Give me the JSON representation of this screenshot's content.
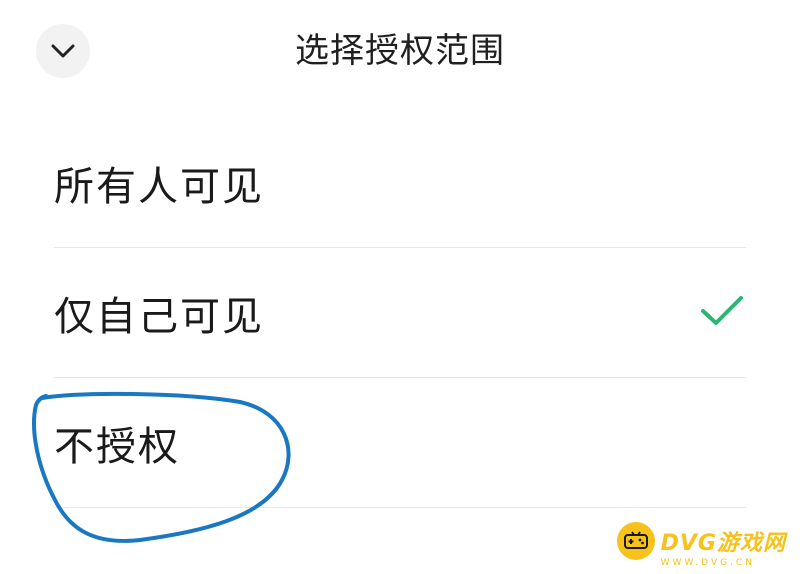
{
  "header": {
    "back_icon": "chevron-down-icon",
    "title": "选择授权范围"
  },
  "options": [
    {
      "label": "所有人可见",
      "selected": false
    },
    {
      "label": "仅自己可见",
      "selected": true
    },
    {
      "label": "不授权",
      "selected": false
    }
  ],
  "selection_check_icon": "checkmark-icon",
  "annotation": {
    "shape": "hand-drawn-ellipse",
    "target": "不授权",
    "color": "#1a78c2"
  },
  "watermark": {
    "brand": "DVG游戏网",
    "url": "WWW.DVG.CN",
    "color": "#f6c21b"
  },
  "colors": {
    "check": "#2bb673",
    "divider": "#e8e8e8",
    "back_button_bg": "#f2f2f2"
  }
}
